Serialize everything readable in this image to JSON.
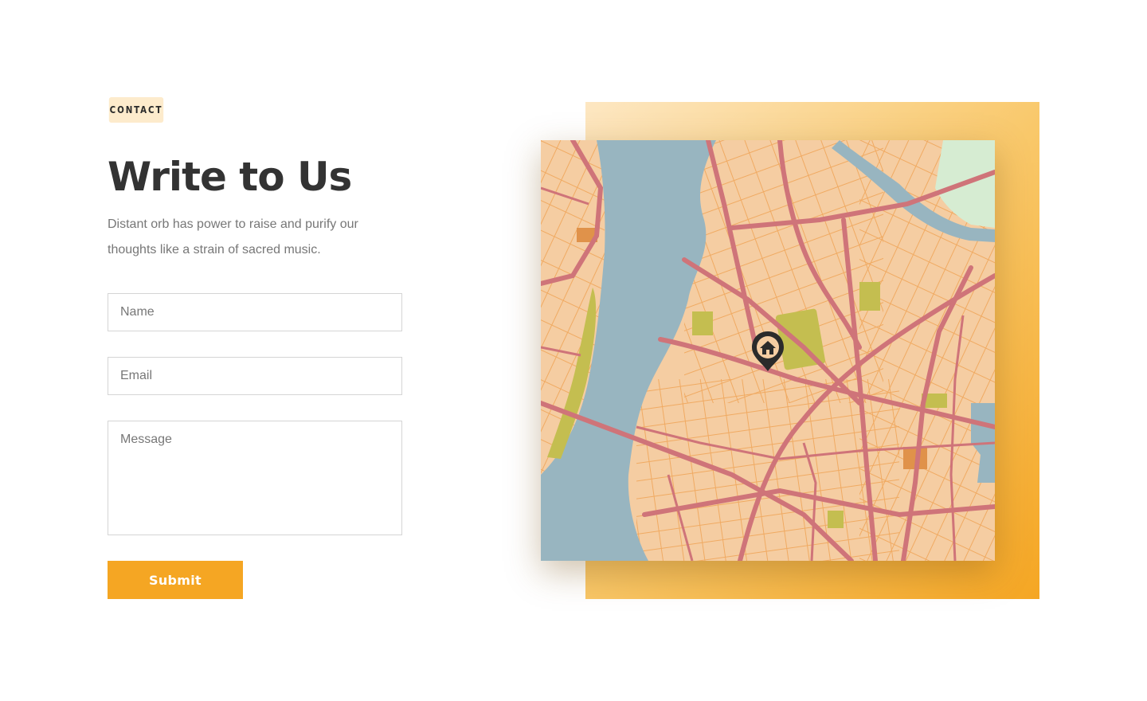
{
  "section": {
    "badge": "CONTACT",
    "title": "Write to Us",
    "description": "Distant orb has power to raise and purify our thoughts like a strain of sacred music."
  },
  "form": {
    "name_placeholder": "Name",
    "email_placeholder": "Email",
    "message_placeholder": "Message",
    "submit_label": "Submit"
  },
  "map": {
    "marker_icon": "home-marker-icon"
  },
  "colors": {
    "accent": "#f5a623",
    "badge_bg": "#fdebcc",
    "heading": "#333333",
    "body_text": "#777777",
    "water": "#98b5c0",
    "land": "#f5cda2",
    "road_major": "#cf7479",
    "road_minor": "#f0aa62",
    "park": "#c4be50"
  }
}
